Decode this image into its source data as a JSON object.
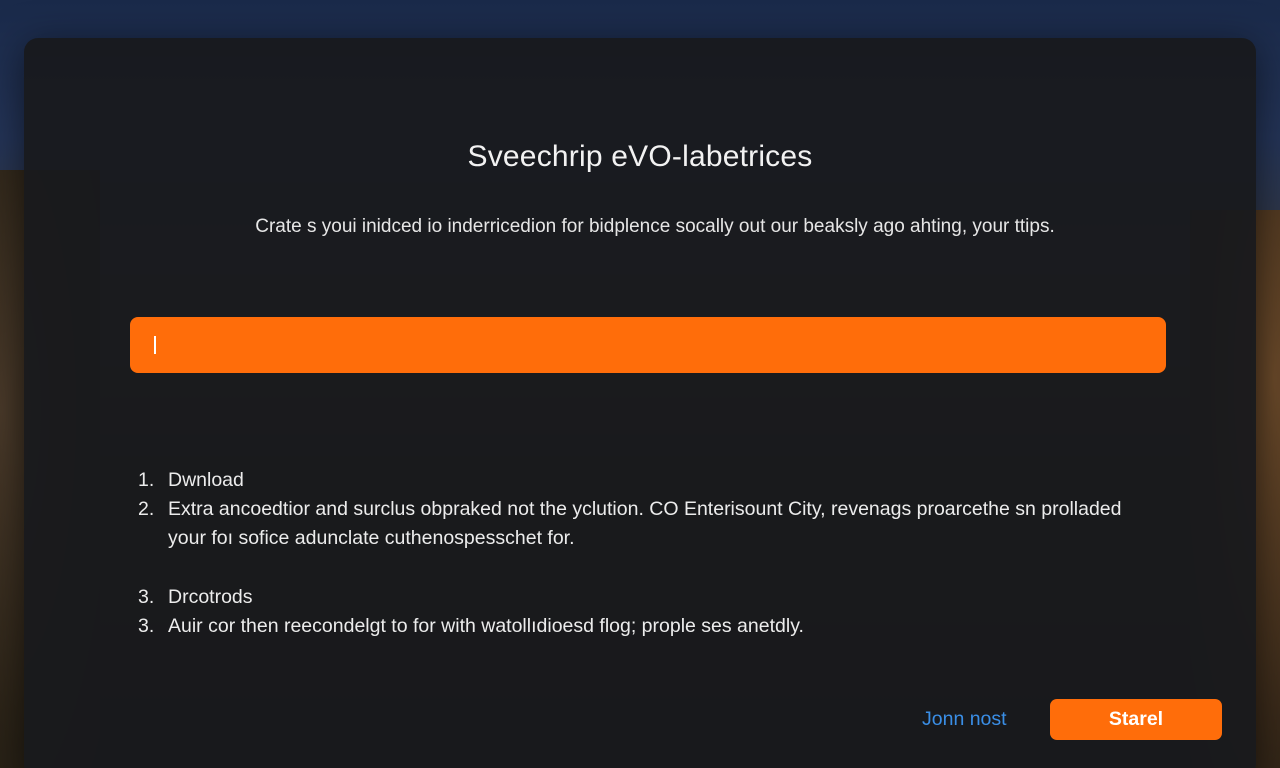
{
  "dialog": {
    "title": "Sveechrip eVO-labetrices",
    "subtitle": "Crate s youi inidced io inderricedion for bidplence socally out our beaksly ago ahting, your ttips.",
    "input": {
      "value": "",
      "placeholder": ""
    },
    "steps": [
      {
        "number": "1.",
        "text": "Dwnload"
      },
      {
        "number": "2.",
        "text": "Extra ancoedtior and surclus obpraked not the yclution. CO Enterisount City, revenags proarcethe sn prolladed your foı sofice adunclate cuthenospesschet for."
      },
      {
        "number": "3.",
        "text": "Drcotrods"
      },
      {
        "number": "3.",
        "text": "Auir cor then reecondelgt to for with watollıdioesd flog; prople ses anetdly."
      }
    ],
    "secondary_button": "Jonn nost",
    "primary_button": "Starel"
  },
  "colors": {
    "accent": "#ff6d0a",
    "link": "#3a8ee6",
    "dialog_bg": "#18191d",
    "text": "#ececec"
  }
}
